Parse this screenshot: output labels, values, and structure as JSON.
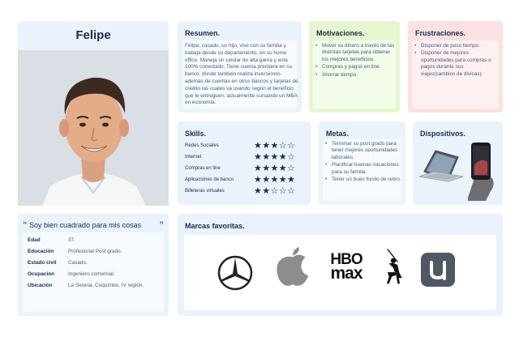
{
  "profile": {
    "name": "Felipe"
  },
  "summary": {
    "title": "Resumen.",
    "text": "Felipe, casado, un hijo, vive con su familia y trabaja desde su departamento, en su home office. Maneja un celular de alta gama y esta 100% conectado. Tiene cuenta premiere en su banco, donde también realiza inversiones además de cuentas en otros bancos y tarjetas de crédito las cuales va usando según el beneficio que le entreguen, actualmente cursando un MBA en economia."
  },
  "motivations": {
    "title": "Motivaciones.",
    "items": [
      "Mover su dinero a través de las distintas tarjetas para obtener los mejores beneficios.",
      "Compras y pagos en line.",
      "Ahorrar tiempo."
    ]
  },
  "frustrations": {
    "title": "Frustraciones.",
    "items": [
      "Disponer de poco tiempo.",
      "Disponer de mejores oportunidades para  compras o pagos durante sus viajes(cambios de divisas)."
    ]
  },
  "skills": {
    "title": "Skills.",
    "items": [
      {
        "name": "Redes Sociales",
        "rating": 3,
        "max": 5
      },
      {
        "name": "Internet",
        "rating": 4,
        "max": 5
      },
      {
        "name": "Compras en line",
        "rating": 4,
        "max": 5
      },
      {
        "name": "Aplicaciones de banco",
        "rating": 5,
        "max": 5
      },
      {
        "name": "Billeteras virtuales",
        "rating": 2,
        "max": 5
      }
    ]
  },
  "goals": {
    "title": "Metas.",
    "items": [
      "Terminar su post grado para tener mejores oportunidades laborales.",
      "Planificar buenas vacaciones para su familia",
      "Tener un buen fondo de retiro."
    ]
  },
  "devices": {
    "title": "Dispositivos."
  },
  "quote": {
    "open": "“",
    "text": "Soy bien cuadrado para mis cosas",
    "close": "”"
  },
  "info": [
    {
      "label": "Edad",
      "value": "37."
    },
    {
      "label": "Educación",
      "value": "Profesional Post grado."
    },
    {
      "label": "Estado civil",
      "value": "Casado."
    },
    {
      "label": "Ocupación",
      "value": "Ingeniero comercial."
    },
    {
      "label": "Ubicación",
      "value": "La Serena, Coquimbo, IV región."
    }
  ],
  "brands": {
    "title": "Marcas favoritas.",
    "hbo_top": "HBO",
    "hbo_bottom": "max",
    "logos": [
      "mercedes-benz-logo",
      "apple-logo",
      "hbo-max-logo",
      "polo-ralph-lauren-logo",
      "uber-eats-style-logo"
    ]
  },
  "colors": {
    "card_blue": "#eaf3fb",
    "card_green": "#e6f7cf",
    "card_pink": "#fbe1e1",
    "navy": "#1d2b4f",
    "accent": "#3a63c7"
  }
}
